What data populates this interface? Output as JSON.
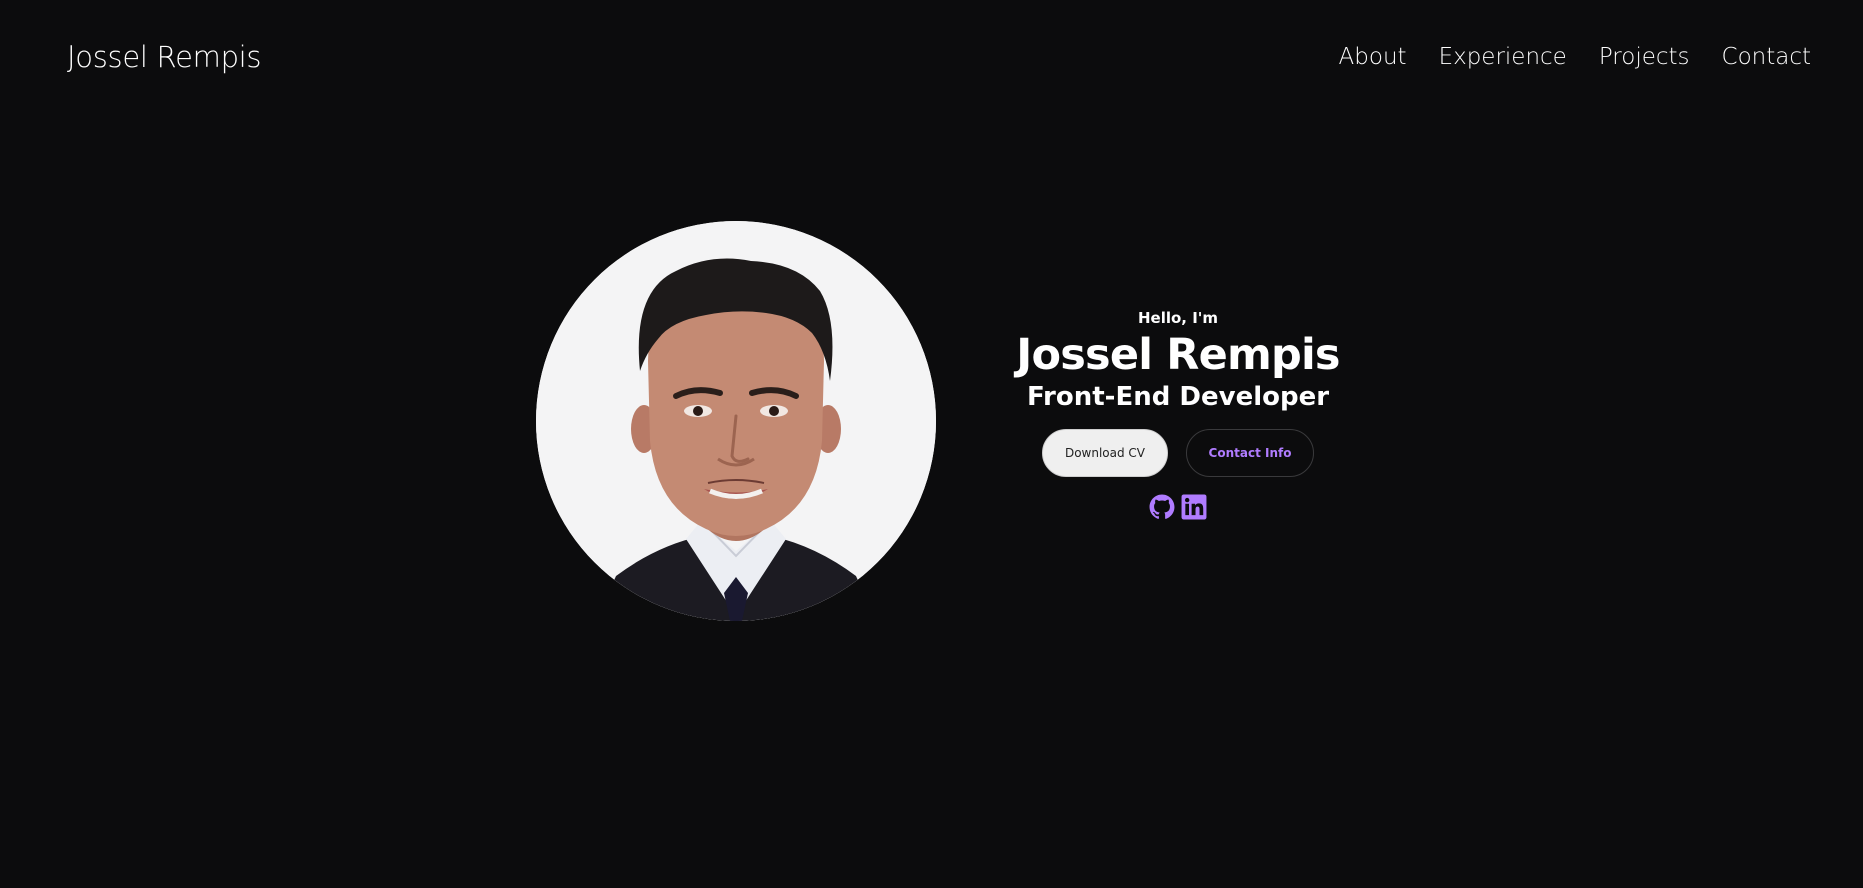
{
  "header": {
    "logo_text": "Jossel Rempis",
    "nav": [
      {
        "label": "About"
      },
      {
        "label": "Experience"
      },
      {
        "label": "Projects"
      },
      {
        "label": "Contact"
      }
    ]
  },
  "hero": {
    "greeting": "Hello, I'm",
    "name": "Jossel Rempis",
    "role": "Front-End Developer",
    "buttons": {
      "download_cv": "Download CV",
      "contact_info": "Contact Info"
    },
    "socials": [
      {
        "icon": "github-icon"
      },
      {
        "icon": "linkedin-icon"
      }
    ]
  },
  "colors": {
    "background": "#0c0c0d",
    "text": "#ffffff",
    "accent": "#b07cff",
    "button_light": "#efefef"
  }
}
